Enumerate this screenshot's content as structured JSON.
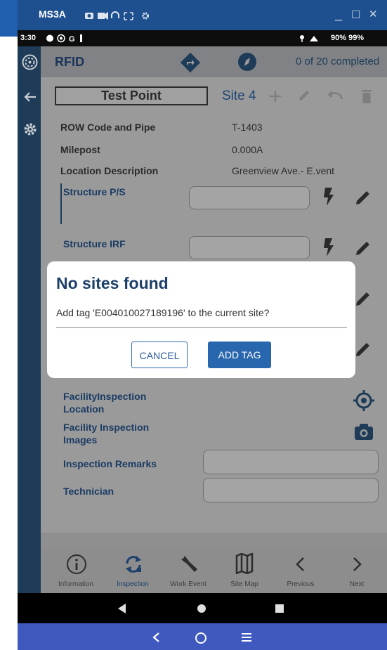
{
  "window": {
    "title": "MS3A",
    "minimize_glyph": "_",
    "maximize_glyph": "☐",
    "close_glyph": "✕"
  },
  "statusbar": {
    "time": "3:30",
    "right": "90%  99%",
    "wifi_battery_text": "≡ 90% ▮99%"
  },
  "appbar": {
    "title": "RFID",
    "progress": "0 of 20 completed"
  },
  "header": {
    "test_point_label": "Test Point",
    "site_label": "Site 4"
  },
  "info": [
    {
      "label": "ROW Code and Pipe",
      "value": "T-1403"
    },
    {
      "label": "Milepost",
      "value": "0.000A"
    },
    {
      "label": "Location Description",
      "value": "Greenview Ave.- E.vent"
    }
  ],
  "fields": {
    "structure_ps": "Structure P/S",
    "structure_irf": "Structure IRF",
    "facility_location": "FacilityInspection Location",
    "facility_images": "Facility Inspection Images",
    "remarks": "Inspection Remarks",
    "technician": "Technician"
  },
  "dialog": {
    "title": "No sites found",
    "message": "Add tag 'E004010027189196' to the current site?",
    "cancel": "CANCEL",
    "add": "ADD TAG"
  },
  "bottom_nav": [
    {
      "label": "Information",
      "icon": "info-icon"
    },
    {
      "label": "Inspection",
      "icon": "refresh-icon",
      "active": true
    },
    {
      "label": "Work Event",
      "icon": "wrench-icon"
    },
    {
      "label": "Site Map",
      "icon": "map-icon"
    },
    {
      "label": "Previous",
      "icon": "chevron-left-icon"
    },
    {
      "label": "Next",
      "icon": "chevron-right-icon"
    }
  ],
  "colors": {
    "titlebar": "#1e4f8f",
    "sidebar": "#1e3c58",
    "accent": "#2866ad",
    "host_nav": "#3f59bf"
  }
}
